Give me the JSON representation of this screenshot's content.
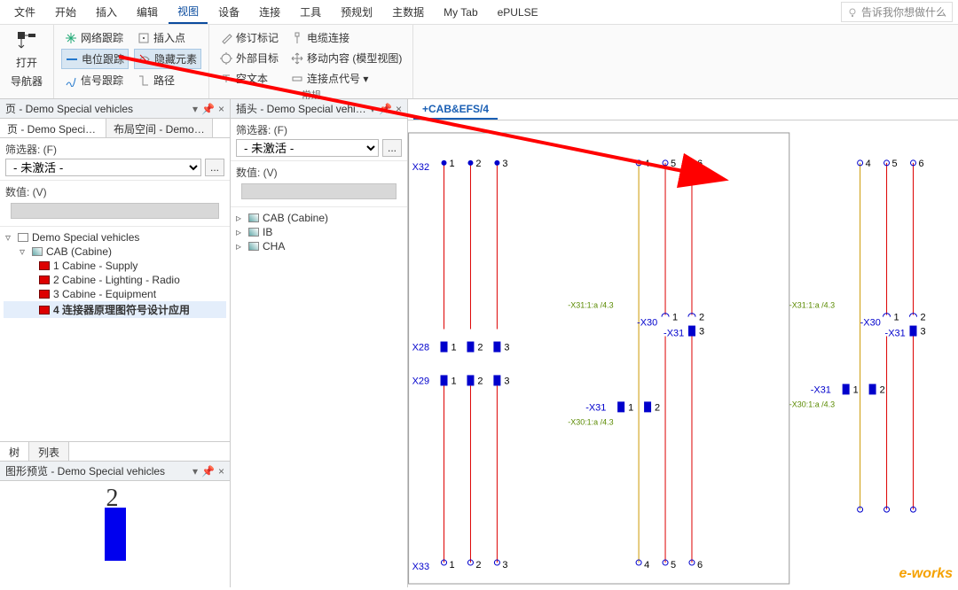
{
  "menu": {
    "items": [
      "文件",
      "开始",
      "插入",
      "编辑",
      "视图",
      "设备",
      "连接",
      "工具",
      "预规划",
      "主数据",
      "My Tab",
      "ePULSE"
    ],
    "activeIndex": 4,
    "searchPlaceholder": "告诉我你想做什么"
  },
  "ribbon": {
    "nav": {
      "label": "打开",
      "sub": "导航器"
    },
    "group1": {
      "rows": [
        [
          {
            "t": "网络跟踪"
          },
          {
            "t": "插入点"
          }
        ],
        [
          {
            "t": "电位跟踪",
            "hl": true
          },
          {
            "t": "隐藏元素",
            "hl": true
          }
        ],
        [
          {
            "t": "信号跟踪"
          },
          {
            "t": "路径"
          }
        ]
      ]
    },
    "group2": {
      "caption": "常规",
      "rows": [
        [
          {
            "t": "修订标记"
          },
          {
            "t": "电缆连接"
          }
        ],
        [
          {
            "t": "外部目标"
          },
          {
            "t": "移动内容 (模型视图)"
          }
        ],
        [
          {
            "t": "空文本"
          },
          {
            "t": "连接点代号 ▾"
          }
        ]
      ]
    }
  },
  "leftPanel": {
    "title": "页 - Demo Special vehicles",
    "tabs": [
      "页 - Demo Special ve...",
      "布局空间 - Demo Spe..."
    ],
    "filterLabel": "筛选器: (F)",
    "filterValue": "- 未激活 -",
    "valueLabel": "数值: (V)",
    "tree": {
      "root": "Demo Special vehicles",
      "cab": "CAB (Cabine)",
      "children": [
        "1 Cabine - Supply",
        "2 Cabine - Lighting - Radio",
        "3 Cabine - Equipment",
        "4 连接器原理图符号设计应用"
      ]
    },
    "bottomTabs": [
      "树",
      "列表"
    ],
    "preview": {
      "title": "图形预览 - Demo Special vehicles",
      "num": "2"
    }
  },
  "midPanel": {
    "title": "插头 - Demo Special vehicles",
    "filterLabel": "筛选器: (F)",
    "filterValue": "- 未激活 -",
    "valueLabel": "数值: (V)",
    "tree": [
      "CAB (Cabine)",
      "IB",
      "CHA"
    ]
  },
  "canvas": {
    "tab": "+CAB&EFS/4",
    "labels": {
      "X32": "X32",
      "X28": "X28",
      "X29": "X29",
      "X33": "X33",
      "mX30": "-X30",
      "mX31": "-X31",
      "g1": "-X31:1:a /4.3",
      "g2": "-X30:1:a /4.3"
    }
  },
  "logo": "e-works"
}
